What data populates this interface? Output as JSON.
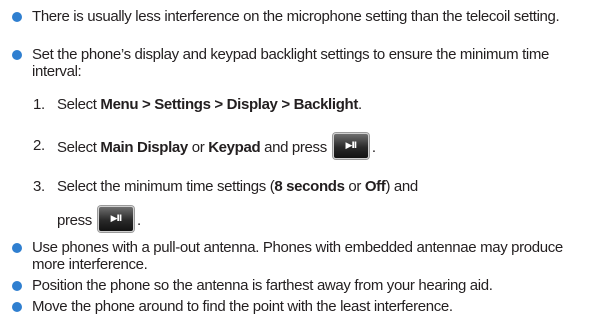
{
  "bullets": [
    "There is usually less interference on the microphone setting than the telecoil setting.",
    "Set the phone’s display and keypad backlight settings to ensure the minimum time interval:",
    "Use phones with a pull-out antenna. Phones with embedded antennae may produce more interference.",
    "Position the phone so the antenna is farthest away from your hearing aid.",
    "Move the phone around to find the point with the least interference."
  ],
  "steps": [
    {
      "num": "1.",
      "pre": "Select ",
      "b1": "Menu > Settings > Display > Backlight",
      "post": "."
    },
    {
      "num": "2.",
      "pre": "Select ",
      "b1": "Main Display",
      "mid": " or ",
      "b2": "Keypad",
      "post": " and press"
    },
    {
      "num": "3.",
      "pre": "Select the minimum time settings (",
      "b1": "8 seconds",
      "mid": " or ",
      "b2": "Off",
      "post": ") and",
      "line2": "press"
    }
  ],
  "key_label": "▶II",
  "colors": {
    "bullet": "#2f7fd0",
    "text": "#231f20"
  }
}
